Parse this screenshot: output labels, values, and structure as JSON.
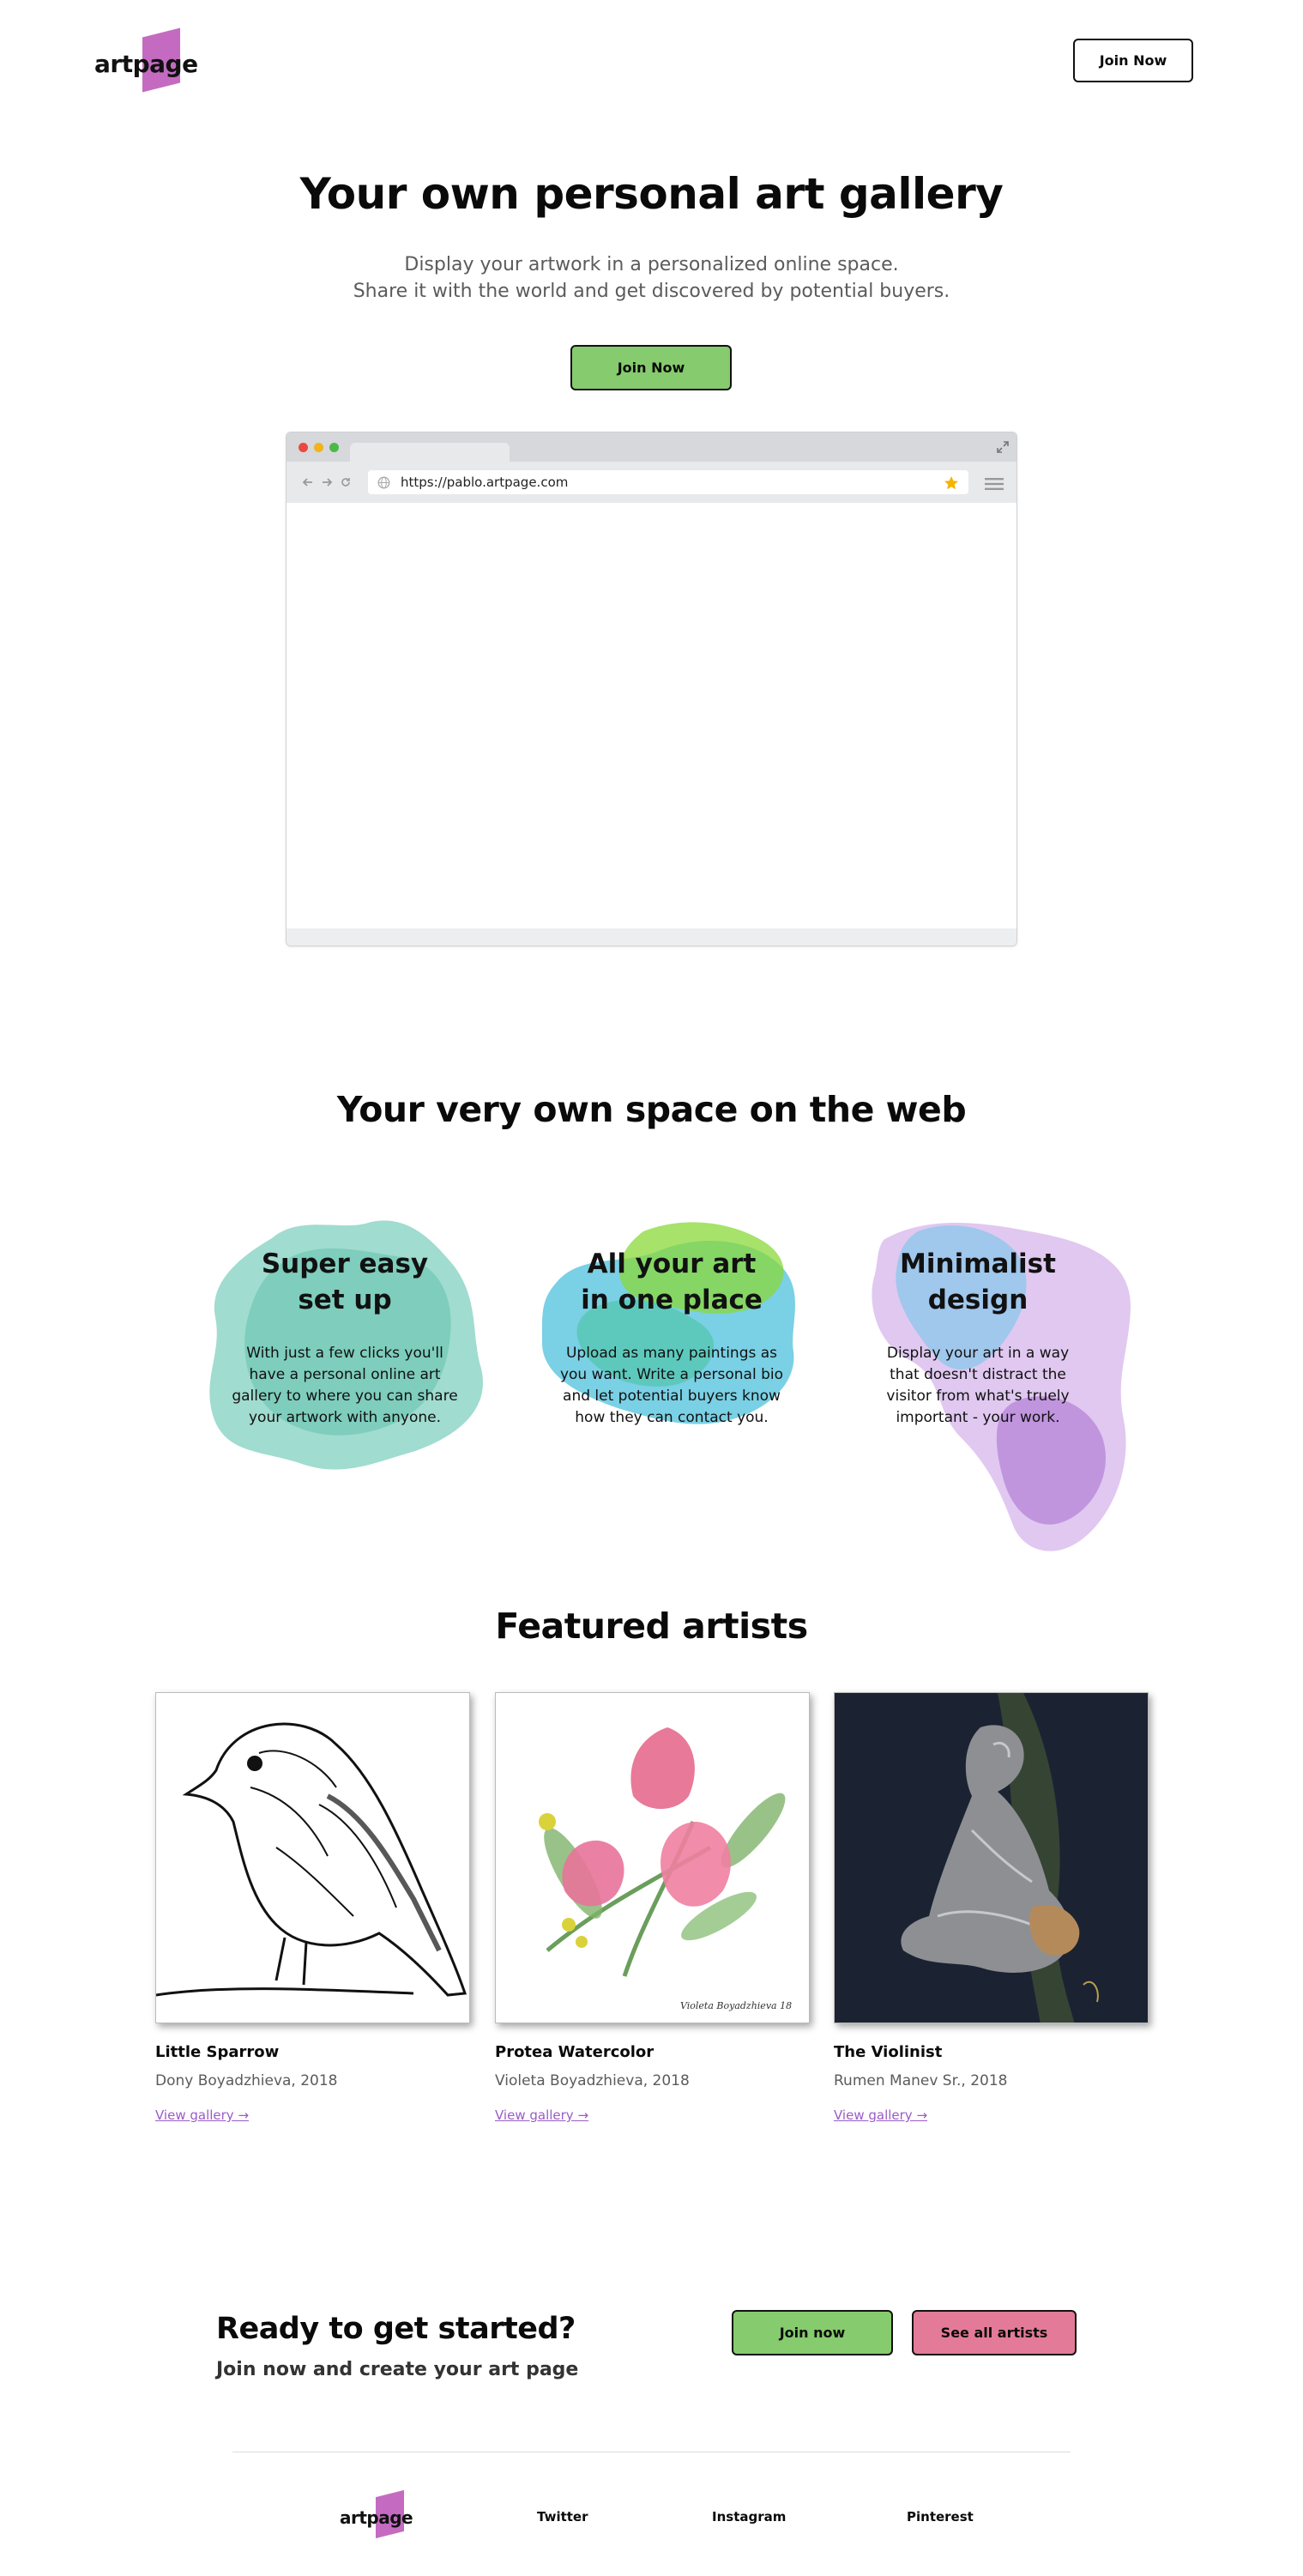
{
  "header": {
    "logo_text": "artpage",
    "join_label": "Join Now"
  },
  "hero": {
    "title": "Your own personal art gallery",
    "subtitle_line1": "Display your artwork in a personalized online space.",
    "subtitle_line2": "Share it with the world and get discovered by potential buyers.",
    "cta_label": "Join Now",
    "browser_url": "https://pablo.artpage.com"
  },
  "features": {
    "heading": "Your very own space on the web",
    "items": [
      {
        "title_line1": "Super easy",
        "title_line2": "set up",
        "text": "With just a few clicks you'll have a personal online art gallery to where you can share your artwork with anyone.",
        "color": "#52bfa8"
      },
      {
        "title_line1": "All your art",
        "title_line2": "in one place",
        "text": "Upload as many paintings as you want. Write a personal bio and let potential buyers know how they can contact you.",
        "color": "#1fb3d6"
      },
      {
        "title_line1": "Minimalist",
        "title_line2": "design",
        "text": "Display your art in a way that doesn't distract the visitor from what's truely important - your work.",
        "color": "#b07fd8"
      }
    ]
  },
  "featured": {
    "heading": "Featured artists",
    "artists": [
      {
        "title": "Little Sparrow",
        "byline": "Dony Boyadzhieva, 2018",
        "link": "View gallery →",
        "image": "bird-sketch"
      },
      {
        "title": "Protea Watercolor",
        "byline": "Violeta Boyadzhieva, 2018",
        "link": "View gallery →",
        "image": "protea-watercolor",
        "signature": "Violeta Boyadzhieva 18"
      },
      {
        "title": "The Violinist",
        "byline": "Rumen Manev Sr., 2018",
        "link": "View gallery →",
        "image": "violinist-painting"
      }
    ]
  },
  "cta": {
    "title": "Ready to get started?",
    "subtitle": "Join now and create your art page",
    "join_label": "Join now",
    "artists_label": "See all artists"
  },
  "footer": {
    "logo_text": "artpage",
    "links": [
      "Twitter",
      "Instagram",
      "Pinterest"
    ]
  },
  "colors": {
    "brand": "#c46bc1",
    "green": "#86cb6d",
    "pink": "#e37b98",
    "link": "#9b5cc6"
  }
}
